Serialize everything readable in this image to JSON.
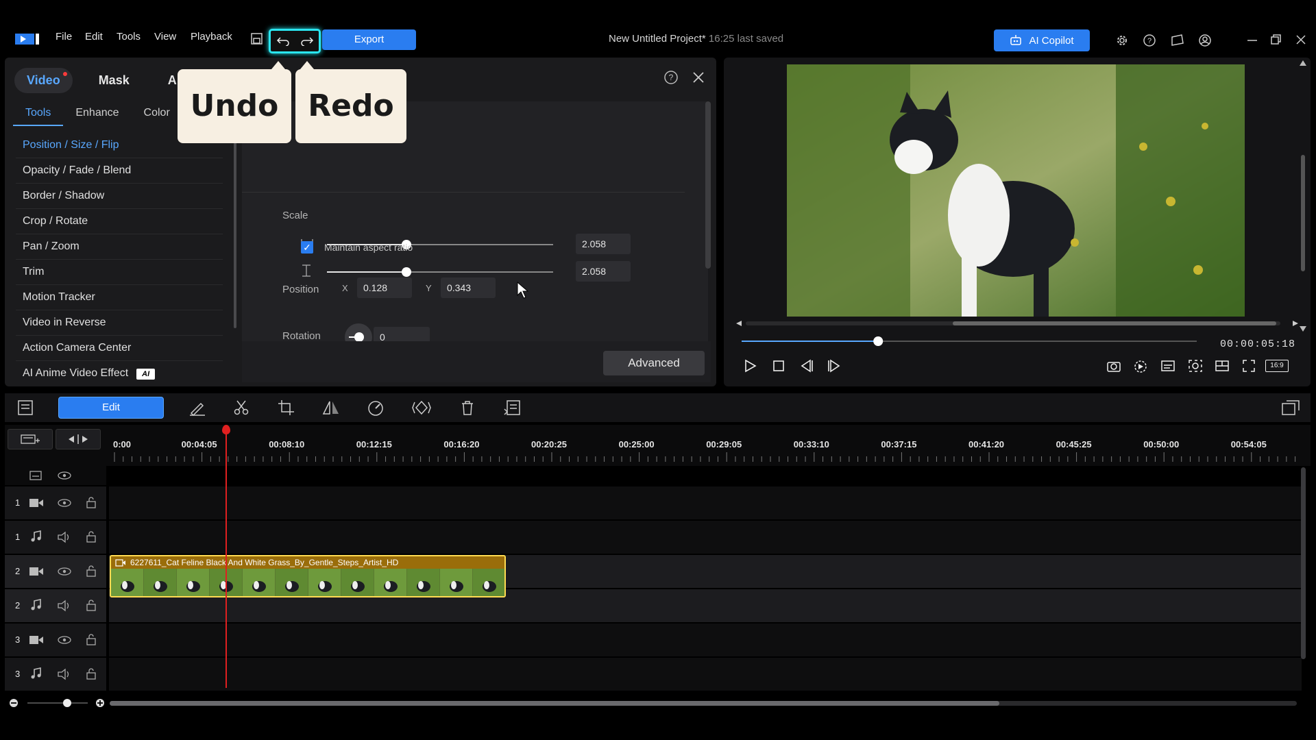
{
  "menu": {
    "file": "File",
    "edit": "Edit",
    "tools": "Tools",
    "view": "View",
    "playback": "Playback"
  },
  "export_label": "Export",
  "project": {
    "title": "New Untitled Project*",
    "saved": "16:25 last saved"
  },
  "copilot_label": "AI Copilot",
  "panel": {
    "main_tabs": [
      "Video",
      "Mask",
      "A"
    ],
    "sub_tabs": [
      "Tools",
      "Enhance",
      "Color"
    ],
    "tools": [
      "Position / Size / Flip",
      "Opacity / Fade / Blend",
      "Border / Shadow",
      "Crop / Rotate",
      "Pan / Zoom",
      "Trim",
      "Motion Tracker",
      "Video in Reverse",
      "Action Camera Center",
      "AI Anime Video Effect"
    ],
    "ai_badge": "AI",
    "scale_label": "Scale",
    "scale_w": "2.058",
    "scale_h": "2.058",
    "scale_level": 0.35,
    "aspect_label": "Maintain aspect ratio",
    "position_label": "Position",
    "x_label": "X",
    "x_value": "0.128",
    "y_label": "Y",
    "y_value": "0.343",
    "rotation_label": "Rotation",
    "rotation_value": "0",
    "advanced_label": "Advanced"
  },
  "callouts": {
    "undo": "Undo",
    "redo": "Redo"
  },
  "preview": {
    "time": "00:00:05:18",
    "progress": 0.3,
    "aspect": "16:9"
  },
  "timeline": {
    "edit_label": "Edit",
    "ruler": [
      "0:00",
      "00:04:05",
      "00:08:10",
      "00:12:15",
      "00:16:20",
      "00:20:25",
      "00:25:00",
      "00:29:05",
      "00:33:10",
      "00:37:15",
      "00:41:20",
      "00:45:25",
      "00:50:00",
      "00:54:05"
    ],
    "track_numbers": [
      "1",
      "1",
      "2",
      "2",
      "3",
      "3"
    ],
    "clip_name": "6227611_Cat Feline Black And White Grass_By_Gentle_Steps_Artist_HD"
  }
}
